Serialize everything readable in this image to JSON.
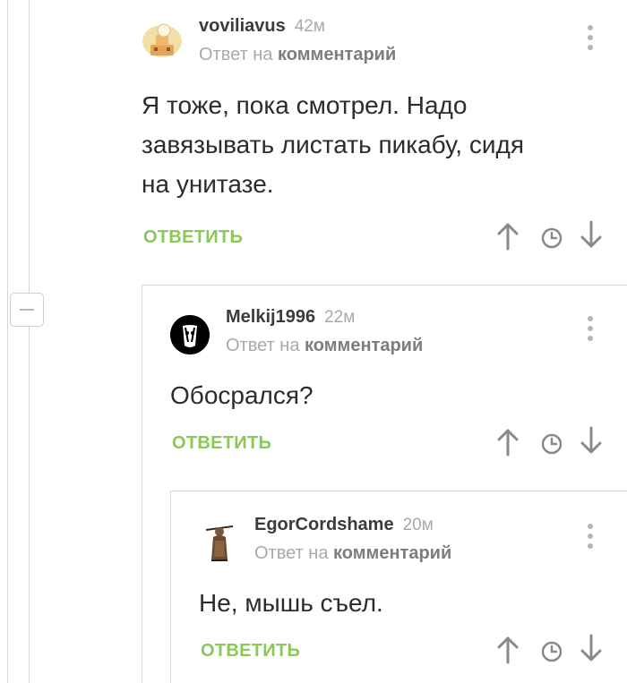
{
  "comments": [
    {
      "username": "voviliavus",
      "time": "42м",
      "reply_prefix": "Ответ на",
      "reply_target": "комментарий",
      "lines": [
        "Я тоже, пока смотрел. Надо",
        "завязывать листать пикабу, сидя",
        "на унитазе."
      ],
      "reply_label": "ОТВЕТИТЬ"
    },
    {
      "username": "Melkij1996",
      "time": "22м",
      "reply_prefix": "Ответ на",
      "reply_target": "комментарий",
      "lines": [
        "Обосрался?"
      ],
      "reply_label": "ОТВЕТИТЬ"
    },
    {
      "username": "EgorCordshame",
      "time": "20м",
      "reply_prefix": "Ответ на",
      "reply_target": "комментарий",
      "lines": [
        "Не, мышь съел."
      ],
      "reply_label": "ОТВЕТИТЬ"
    }
  ],
  "colors": {
    "accent_green": "#8ac858",
    "username": "#3b3b3b",
    "meta_gray": "#a9a9a9",
    "icon_gray": "#b5b5b5"
  },
  "icons": [
    "more-vertical-icon",
    "arrow-up-icon",
    "clock-icon",
    "arrow-down-icon",
    "collapse-minus-icon"
  ]
}
